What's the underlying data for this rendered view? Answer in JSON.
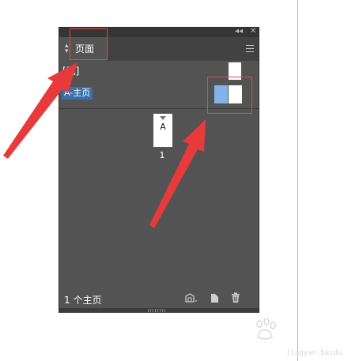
{
  "panel": {
    "tab_label": "页面",
    "none_label": "[无]",
    "master_label": "A-主页",
    "page_prefix": "A",
    "page_number": "1",
    "status_text": "1 个主页"
  },
  "icons": {
    "collapse": "double-chevron-left-icon",
    "close": "close-icon",
    "menu": "menu-icon",
    "tab_arrows": "up-down-arrows-icon",
    "edit_page_size": "edit-page-size-icon",
    "new_page": "new-page-icon",
    "delete": "trash-icon"
  },
  "colors": {
    "panel_bg": "#535353",
    "tab_strip": "#424242",
    "selection": "#3b6fae",
    "annotation": "#e24a4a",
    "spread_selected": "#82b4ea"
  },
  "watermark": {
    "logo_text": "Baidu经验",
    "url_text": "jingyan.baidu.com"
  }
}
